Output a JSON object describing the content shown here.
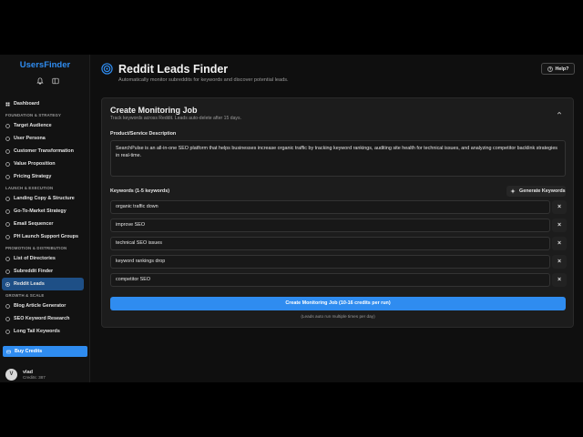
{
  "app": {
    "logo": "UsersFinder"
  },
  "sidebar": {
    "sections": [
      {
        "title": "",
        "items": [
          {
            "label": "Dashboard",
            "icon": "dashboard-icon"
          }
        ]
      },
      {
        "title": "FOUNDATION & STRATEGY",
        "items": [
          {
            "label": "Target Audience",
            "icon": "target-icon"
          },
          {
            "label": "User Persona",
            "icon": "user-icon"
          },
          {
            "label": "Customer Transformation",
            "icon": "transform-icon"
          },
          {
            "label": "Value Proposition",
            "icon": "star-icon"
          },
          {
            "label": "Pricing Strategy",
            "icon": "dollar-icon"
          }
        ]
      },
      {
        "title": "LAUNCH & EXECUTION",
        "items": [
          {
            "label": "Landing Copy & Structure",
            "icon": "document-icon"
          },
          {
            "label": "Go-To-Market Strategy",
            "icon": "strategy-icon"
          },
          {
            "label": "Email Sequencer",
            "icon": "mail-icon"
          },
          {
            "label": "PH Launch Support Groups",
            "icon": "group-icon"
          }
        ]
      },
      {
        "title": "PROMOTION & DISTRIBUTION",
        "items": [
          {
            "label": "List of Directories",
            "icon": "list-icon"
          },
          {
            "label": "Subreddit Finder",
            "icon": "reddit-icon"
          },
          {
            "label": "Reddit Leads",
            "icon": "radar-icon",
            "active": true
          }
        ]
      },
      {
        "title": "GROWTH & SCALE",
        "items": [
          {
            "label": "Blog Article Generator",
            "icon": "pen-icon"
          },
          {
            "label": "SEO Keyword Research",
            "icon": "search-icon"
          },
          {
            "label": "Long Tail Keywords",
            "icon": "keyword-icon"
          }
        ]
      }
    ],
    "buy_credits": "Buy Credits",
    "user": {
      "avatar_letter": "V",
      "name": "vlad",
      "credits": "Credits: 387"
    }
  },
  "header": {
    "title": "Reddit Leads Finder",
    "subtitle": "Automatically monitor subreddits for keywords and discover potential leads.",
    "help_label": "Help?"
  },
  "job_card": {
    "title": "Create Monitoring Job",
    "subtitle": "Track keywords across Reddit. Leads auto-delete after 15 days.",
    "description_label": "Product/Service Description",
    "description_value": "SearchPulse is an all-in-one SEO platform that helps businesses increase organic traffic by tracking keyword rankings, auditing site health for technical issues, and analyzing competitor backlink strategies in real-time.",
    "keywords_label": "Keywords (1-5 keywords)",
    "generate_label": "Generate Keywords",
    "keywords": [
      "organic traffic down",
      "improve SEO",
      "technical SEO issues",
      "keyword rankings drop",
      "competitor SEO"
    ],
    "remove_symbol": "×",
    "submit_label": "Create Monitoring Job (10-16 credits per run)",
    "submit_note": "(Leads auto run multiple times per day)"
  },
  "colors": {
    "accent": "#2f8cf0",
    "active_nav": "#1e4f86",
    "background": "#0f0f0f",
    "card": "#1c1c1c"
  }
}
